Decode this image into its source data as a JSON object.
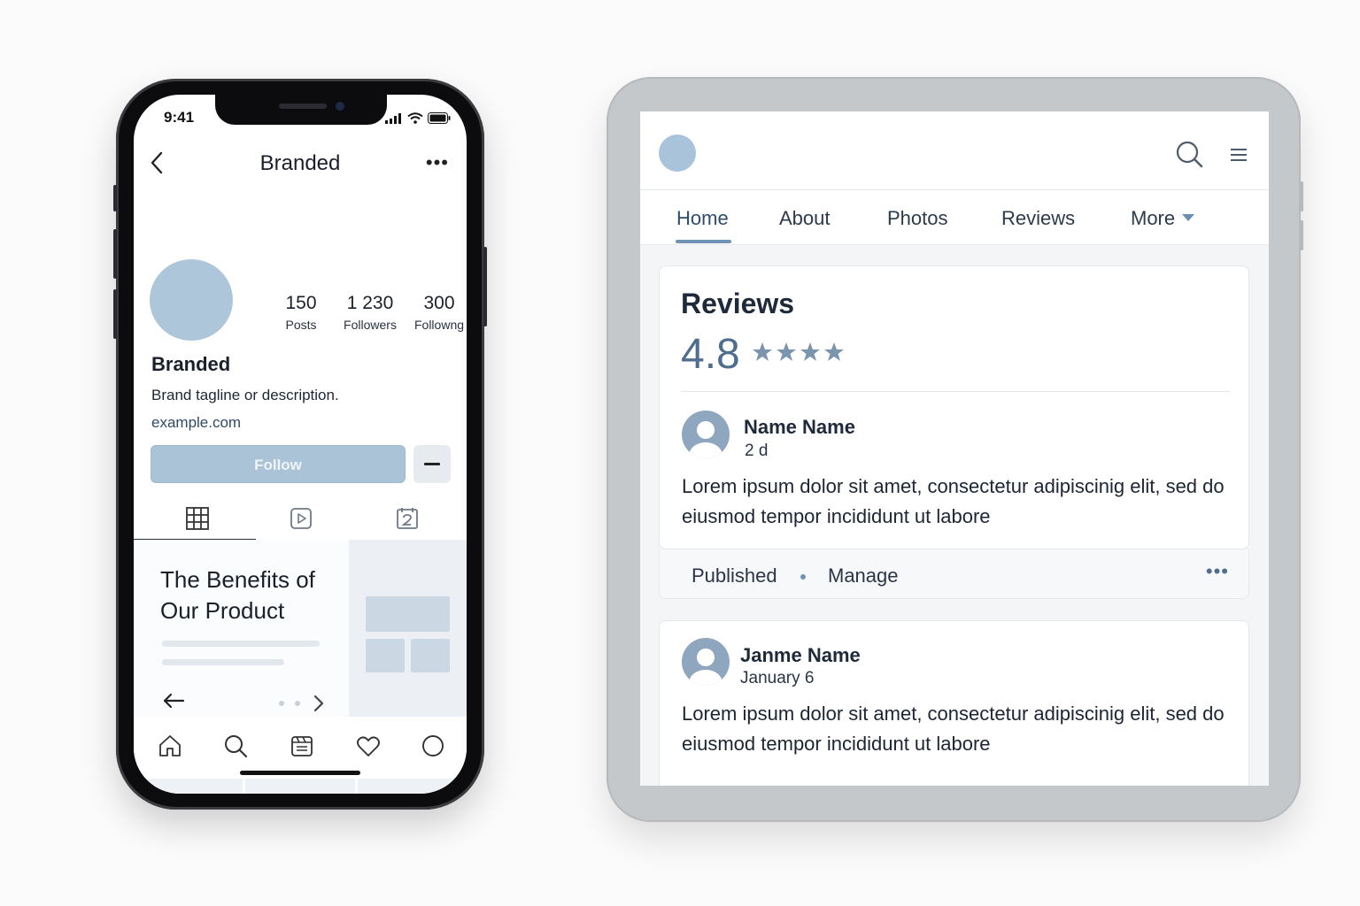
{
  "phone": {
    "status_time": "9:41",
    "header_title": "Branded",
    "stats": [
      {
        "value": "150",
        "label": "Posts"
      },
      {
        "value": "1 230",
        "label": "Followers"
      },
      {
        "value": "300",
        "label": "Followng"
      }
    ],
    "profile_name": "Branded",
    "tagline": "Brand tagline or description.",
    "link": "example.com",
    "follow_label": "Follow",
    "card_title": "The Benefits of Our Product",
    "nav_icons": [
      "home-icon",
      "search-icon",
      "reels-icon",
      "heart-icon",
      "profile-icon"
    ]
  },
  "tablet": {
    "nav_items": [
      "Home",
      "About",
      "Photos",
      "Reviews",
      "More"
    ],
    "active_nav": "Home",
    "reviews_title": "Reviews",
    "rating": "4.8",
    "stars": 4,
    "reviews": [
      {
        "name": "Name Name",
        "date": "2 d",
        "text": "Lorem ipsum dolor sit amet, consectetur adipiscinig elit, sed do eiusmod tempor incididunt ut labore"
      },
      {
        "name": "Janme Name",
        "date": "January 6",
        "text": "Lorem ipsum dolor sit amet, consectetur adipiscinig elit, sed do eiusmod tempor incididunt ut labore"
      }
    ],
    "published_label": "Published",
    "manage_label": "Manage",
    "more_dots": "•••"
  },
  "colors": {
    "accent_light": "#aec6da",
    "accent": "#6e93b5",
    "text_dark": "#1e2a3a"
  }
}
